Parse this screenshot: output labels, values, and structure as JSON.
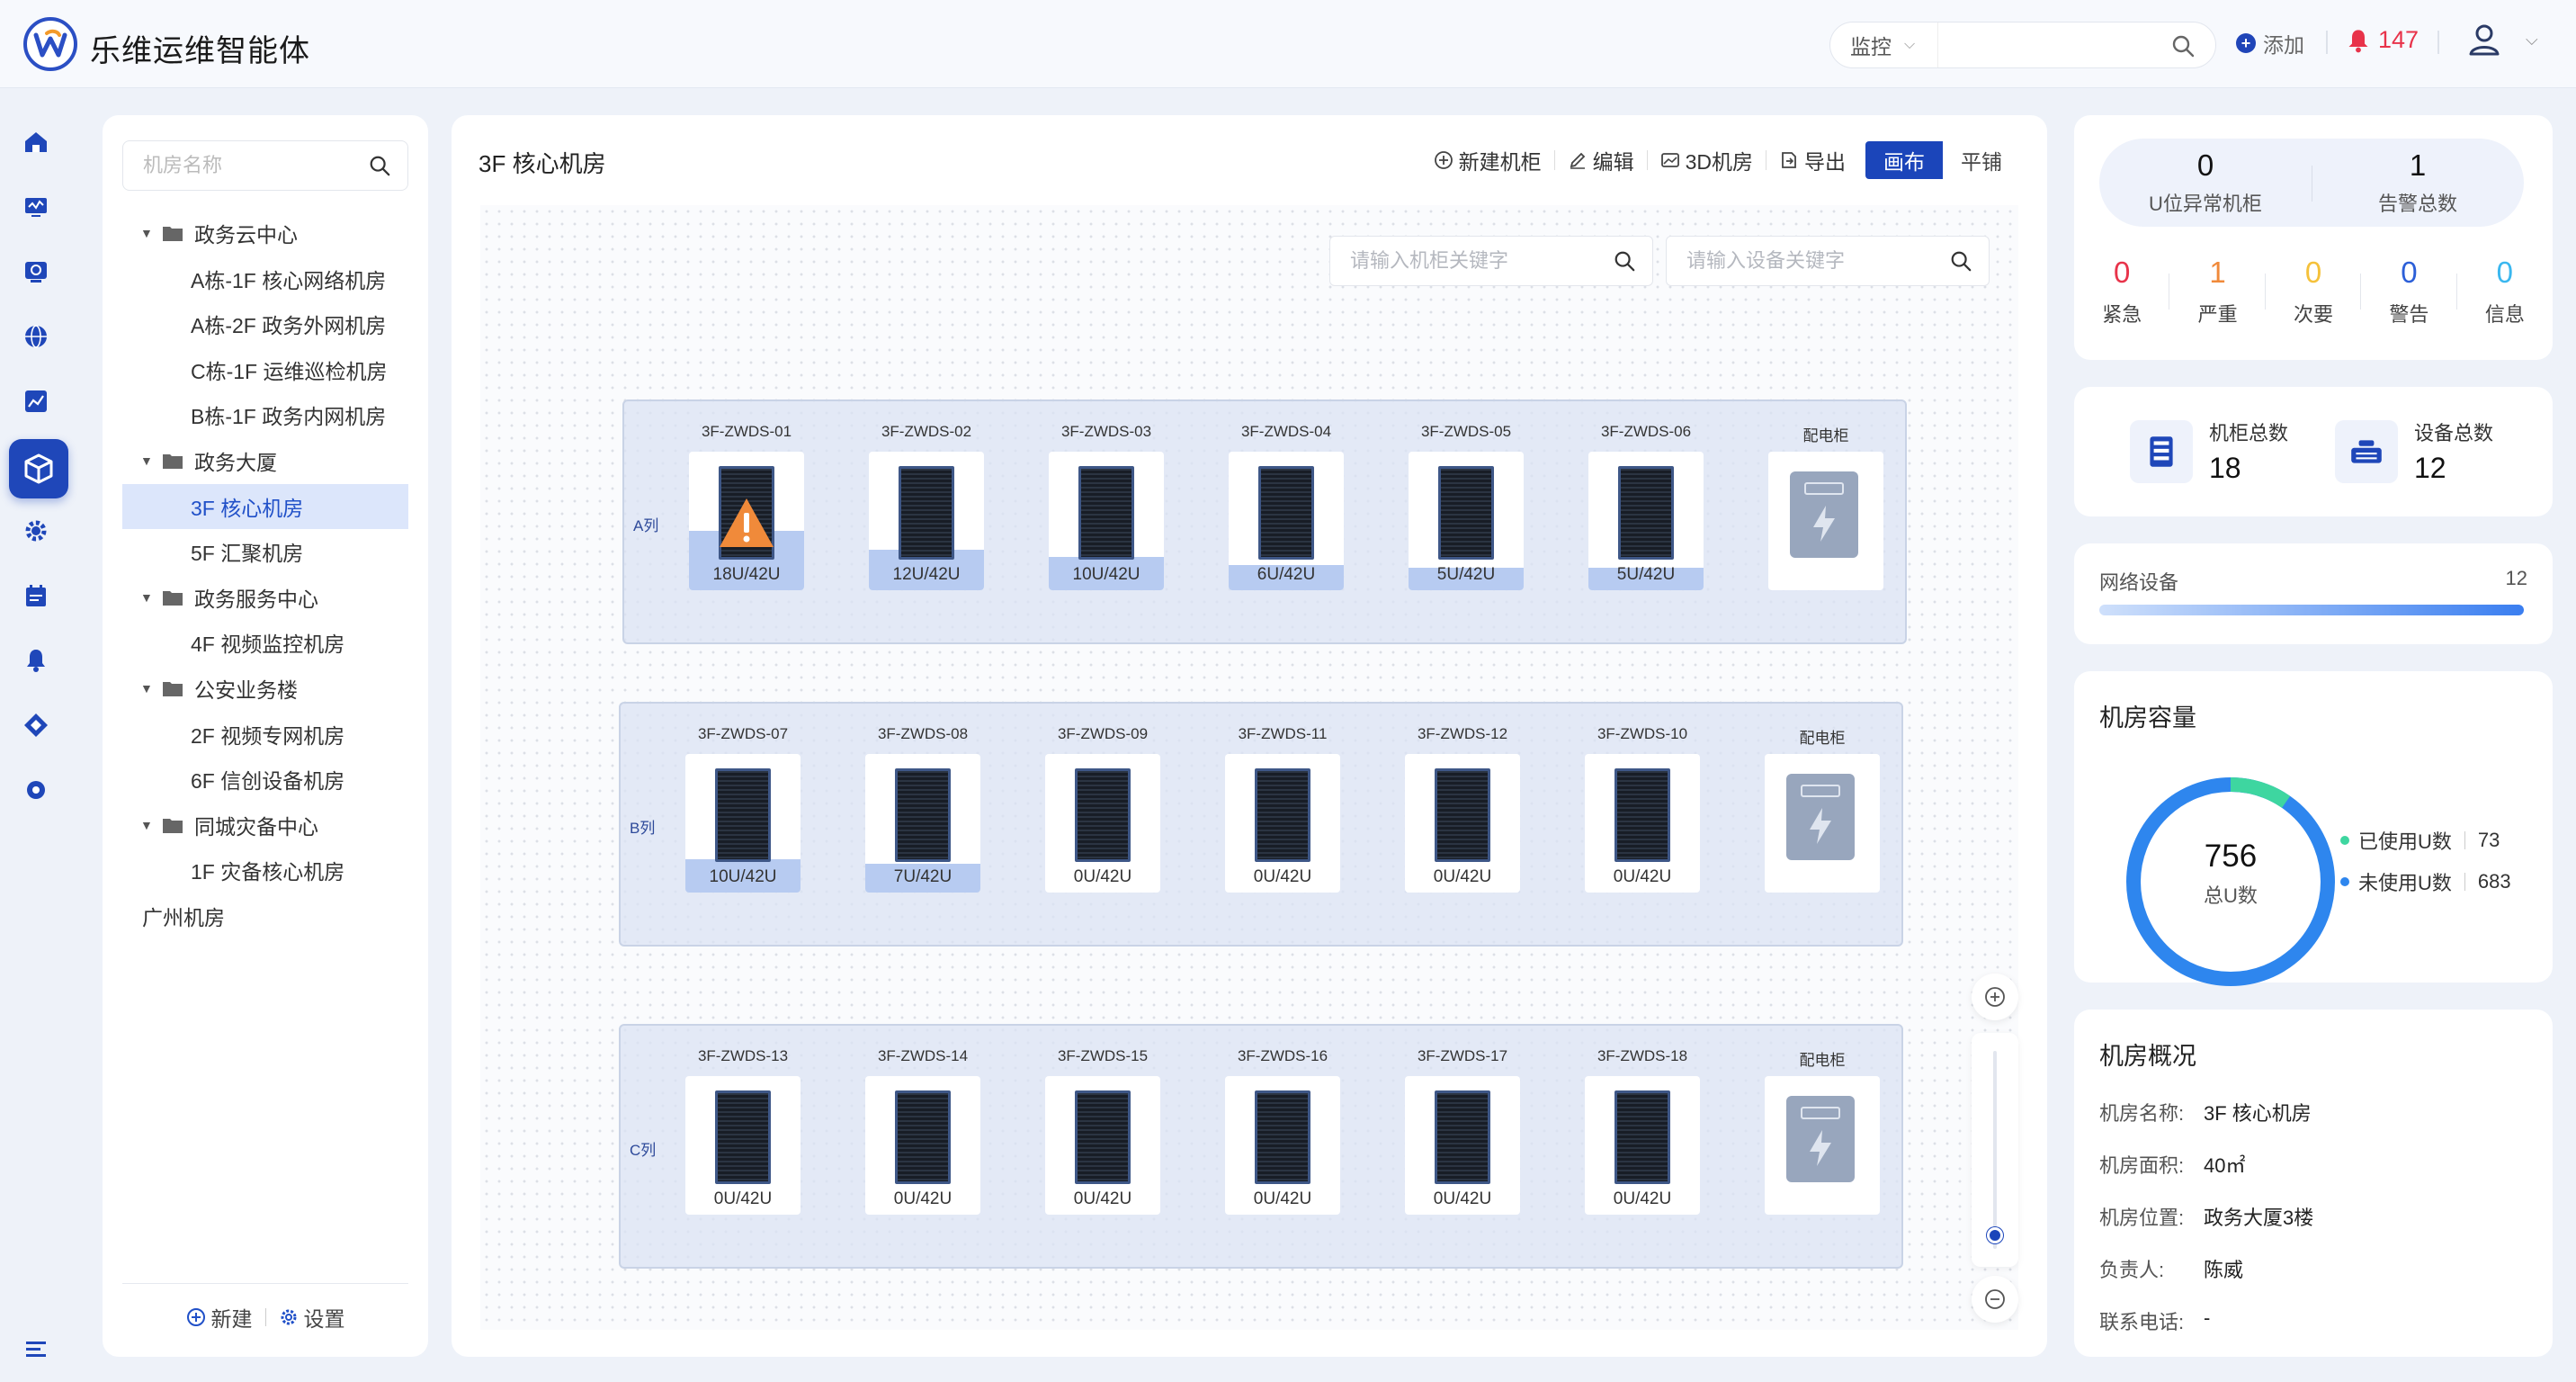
{
  "app": {
    "title": "乐维运维智能体"
  },
  "header": {
    "search_mode": "监控",
    "search_placeholder": "",
    "add_label": "添加",
    "alarm_count": "147"
  },
  "tree": {
    "search_placeholder": "机房名称",
    "nodes": [
      {
        "label": "政务云中心",
        "level": 0,
        "type": "group"
      },
      {
        "label": "A栋-1F 核心网络机房",
        "level": 1,
        "type": "room"
      },
      {
        "label": "A栋-2F 政务外网机房",
        "level": 1,
        "type": "room"
      },
      {
        "label": "C栋-1F 运维巡检机房",
        "level": 1,
        "type": "room"
      },
      {
        "label": "B栋-1F 政务内网机房",
        "level": 1,
        "type": "room"
      },
      {
        "label": "政务大厦",
        "level": 0,
        "type": "group"
      },
      {
        "label": "3F 核心机房",
        "level": 1,
        "type": "room",
        "selected": true
      },
      {
        "label": "5F 汇聚机房",
        "level": 1,
        "type": "room"
      },
      {
        "label": "政务服务中心",
        "level": 0,
        "type": "group"
      },
      {
        "label": "4F 视频监控机房",
        "level": 1,
        "type": "room"
      },
      {
        "label": "公安业务楼",
        "level": 0,
        "type": "group"
      },
      {
        "label": "2F 视频专网机房",
        "level": 1,
        "type": "room"
      },
      {
        "label": "6F 信创设备机房",
        "level": 1,
        "type": "room"
      },
      {
        "label": "同城灾备中心",
        "level": 0,
        "type": "group"
      },
      {
        "label": "1F 灾备核心机房",
        "level": 1,
        "type": "room"
      },
      {
        "label": "广州机房",
        "level": 0,
        "type": "leaf"
      }
    ],
    "footer_new": "新建",
    "footer_settings": "设置"
  },
  "main": {
    "title": "3F 核心机房",
    "toolbar": {
      "new_rack": "新建机柜",
      "edit": "编辑",
      "view3d": "3D机房",
      "export": "导出",
      "mode_canvas": "画布",
      "mode_tile": "平铺"
    },
    "rack_search_placeholder": "请输入机柜关键字",
    "device_search_placeholder": "请输入设备关键字",
    "rows": [
      {
        "label": "A列",
        "racks": [
          {
            "name": "3F-ZWDS-01",
            "usage": "18U/42U",
            "fill": 0.43,
            "alert": true
          },
          {
            "name": "3F-ZWDS-02",
            "usage": "12U/42U",
            "fill": 0.29
          },
          {
            "name": "3F-ZWDS-03",
            "usage": "10U/42U",
            "fill": 0.24
          },
          {
            "name": "3F-ZWDS-04",
            "usage": "6U/42U",
            "fill": 0.14
          },
          {
            "name": "3F-ZWDS-05",
            "usage": "5U/42U",
            "fill": 0.12
          },
          {
            "name": "3F-ZWDS-06",
            "usage": "5U/42U",
            "fill": 0.12
          }
        ],
        "pdu": "配电柜"
      },
      {
        "label": "B列",
        "racks": [
          {
            "name": "3F-ZWDS-07",
            "usage": "10U/42U",
            "fill": 0.24
          },
          {
            "name": "3F-ZWDS-08",
            "usage": "7U/42U",
            "fill": 0.17
          },
          {
            "name": "3F-ZWDS-09",
            "usage": "0U/42U",
            "fill": 0
          },
          {
            "name": "3F-ZWDS-11",
            "usage": "0U/42U",
            "fill": 0
          },
          {
            "name": "3F-ZWDS-12",
            "usage": "0U/42U",
            "fill": 0
          },
          {
            "name": "3F-ZWDS-10",
            "usage": "0U/42U",
            "fill": 0
          }
        ],
        "pdu": "配电柜"
      },
      {
        "label": "C列",
        "racks": [
          {
            "name": "3F-ZWDS-13",
            "usage": "0U/42U",
            "fill": 0
          },
          {
            "name": "3F-ZWDS-14",
            "usage": "0U/42U",
            "fill": 0
          },
          {
            "name": "3F-ZWDS-15",
            "usage": "0U/42U",
            "fill": 0
          },
          {
            "name": "3F-ZWDS-16",
            "usage": "0U/42U",
            "fill": 0
          },
          {
            "name": "3F-ZWDS-17",
            "usage": "0U/42U",
            "fill": 0
          },
          {
            "name": "3F-ZWDS-18",
            "usage": "0U/42U",
            "fill": 0
          }
        ],
        "pdu": "配电柜"
      }
    ]
  },
  "alerts": {
    "u_abnormal_value": "0",
    "u_abnormal_label": "U位异常机柜",
    "total_value": "1",
    "total_label": "告警总数",
    "levels": [
      {
        "label": "紧急",
        "value": "0",
        "color": "#e8334a"
      },
      {
        "label": "严重",
        "value": "1",
        "color": "#f08a3a"
      },
      {
        "label": "次要",
        "value": "0",
        "color": "#f5c13a"
      },
      {
        "label": "警告",
        "value": "0",
        "color": "#2c5fd8"
      },
      {
        "label": "信息",
        "value": "0",
        "color": "#3ab7ef"
      }
    ]
  },
  "stats": {
    "rack_total_label": "机柜总数",
    "rack_total_value": "18",
    "device_total_label": "设备总数",
    "device_total_value": "12"
  },
  "network": {
    "label": "网络设备",
    "value": "12"
  },
  "capacity": {
    "title": "机房容量",
    "total_value": "756",
    "total_label": "总U数",
    "used_label": "已使用U数",
    "used_value": "73",
    "unused_label": "未使用U数",
    "unused_value": "683",
    "used_color": "#3ed6a0",
    "unused_color": "#2e86ee"
  },
  "overview": {
    "title": "机房概况",
    "rows": [
      {
        "key": "机房名称:",
        "value": "3F 核心机房"
      },
      {
        "key": "机房面积:",
        "value": "40㎡"
      },
      {
        "key": "机房位置:",
        "value": "政务大厦3楼"
      },
      {
        "key": "负责人:",
        "value": "陈威"
      },
      {
        "key": "联系电话:",
        "value": "-"
      }
    ]
  }
}
